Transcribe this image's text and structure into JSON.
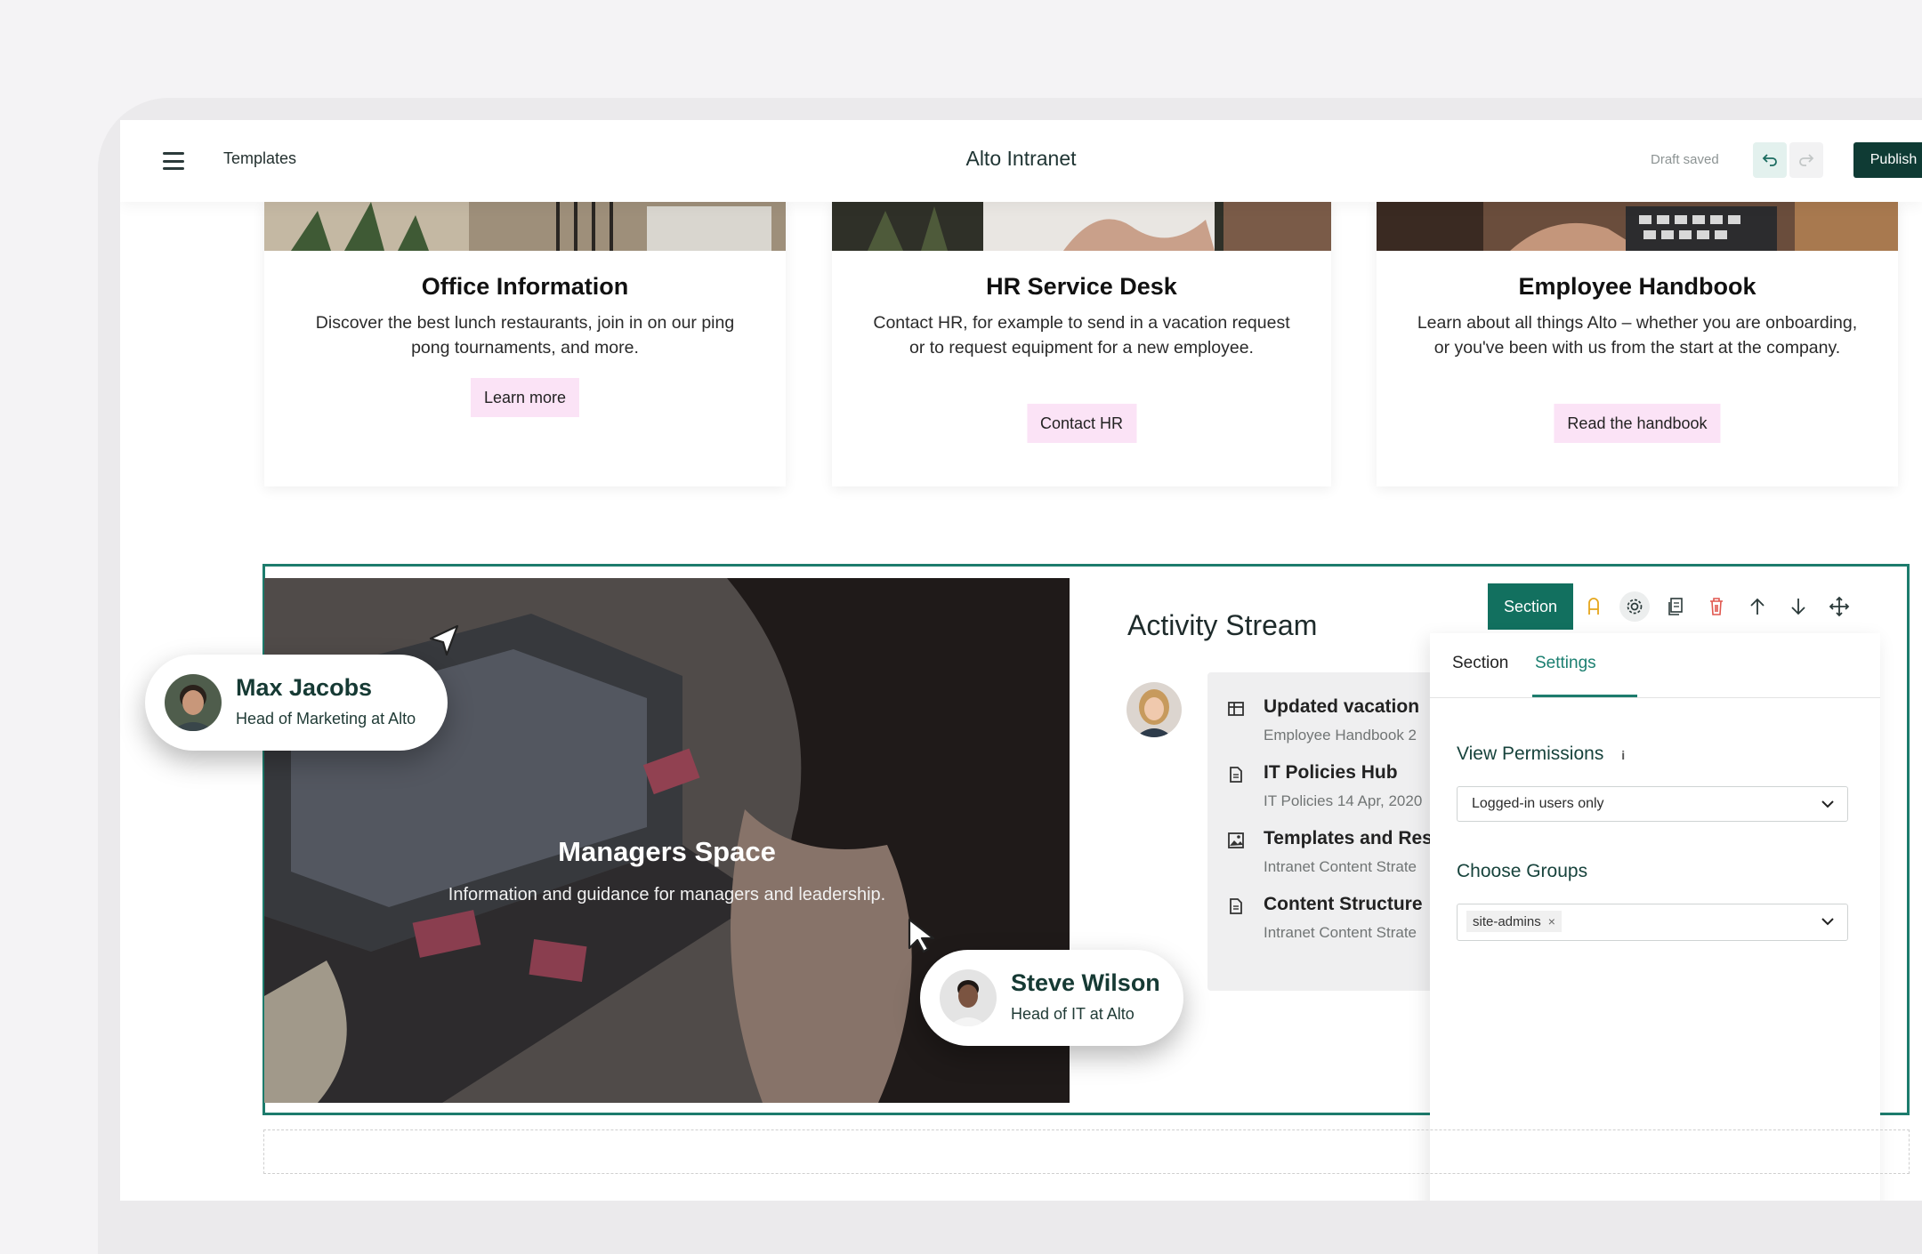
{
  "topbar": {
    "breadcrumb": "Templates",
    "title": "Alto Intranet",
    "status": "Draft saved",
    "publish_label": "Publish"
  },
  "cards": [
    {
      "title": "Office Information",
      "text": "Discover the best lunch restaurants, join in on our ping pong tournaments, and more.",
      "button": "Learn more"
    },
    {
      "title": "HR Service Desk",
      "text": "Contact HR, for example to send in a vacation request or to request equipment for a new employee.",
      "button": "Contact HR"
    },
    {
      "title": "Employee Handbook",
      "text": "Learn about all things Alto – whether you are onboarding, or you've been with us from the start at the company.",
      "button": "Read the handbook"
    }
  ],
  "managers": {
    "title": "Managers Space",
    "subtitle": "Information and guidance for managers and leadership."
  },
  "section_toolbar": {
    "label": "Section"
  },
  "activity": {
    "title": "Activity Stream",
    "items": [
      {
        "title": "Updated vacation",
        "sub": "Employee Handbook   2"
      },
      {
        "title": "IT Policies Hub",
        "sub": "IT Policies   14 Apr, 2020"
      },
      {
        "title": "Templates and Res",
        "sub": "Intranet Content Strate"
      },
      {
        "title": "Content Structure",
        "sub": "Intranet Content Strate"
      }
    ]
  },
  "settings_panel": {
    "tab_section": "Section",
    "tab_settings": "Settings",
    "view_permissions_label": "View Permissions",
    "view_permissions_value": "Logged-in users only",
    "choose_groups_label": "Choose Groups",
    "group_chip": "site-admins"
  },
  "users": [
    {
      "name": "Max Jacobs",
      "role": "Head of Marketing at Alto"
    },
    {
      "name": "Steve Wilson",
      "role": "Head of IT at Alto"
    }
  ],
  "colors": {
    "accent": "#12705f",
    "publish": "#0f3b34",
    "card_button": "#fbe3f6"
  },
  "icons": [
    "menu-icon",
    "undo-icon",
    "redo-icon",
    "lock-icon",
    "gear-icon",
    "copy-icon",
    "trash-icon",
    "arrow-up-icon",
    "arrow-down-icon",
    "move-icon",
    "info-icon",
    "chevron-down-icon",
    "cursor-arrow-icon"
  ]
}
